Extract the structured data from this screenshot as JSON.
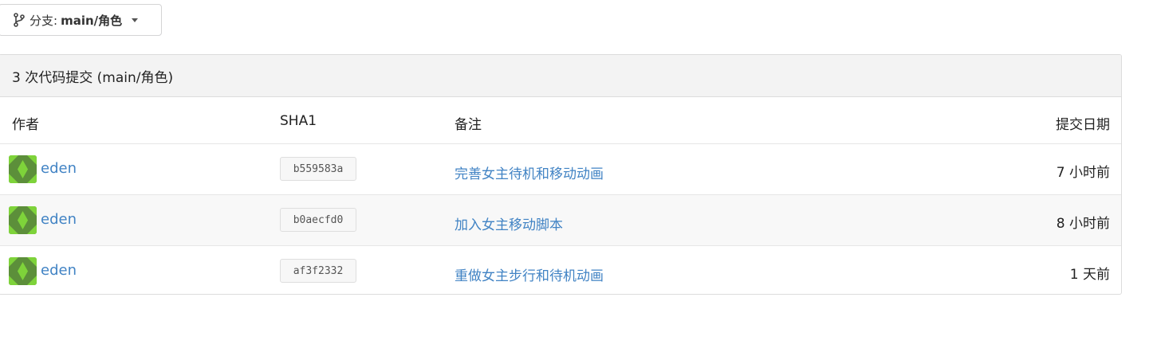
{
  "branch": {
    "prefix": "分支:",
    "name": "main/角色"
  },
  "commits": {
    "header": "3 次代码提交 (main/角色)",
    "columns": {
      "author": "作者",
      "sha": "SHA1",
      "message": "备注",
      "date": "提交日期"
    },
    "rows": [
      {
        "author": "eden",
        "sha": "b559583a",
        "message": "完善女主待机和移动动画",
        "date": "7 小时前"
      },
      {
        "author": "eden",
        "sha": "b0aecfd0",
        "message": "加入女主移动脚本",
        "date": "8 小时前"
      },
      {
        "author": "eden",
        "sha": "af3f2332",
        "message": "重做女主步行和待机动画",
        "date": "1 天前"
      }
    ]
  },
  "colors": {
    "link": "#4183c4",
    "avatar_bg": "#5c8f3a",
    "avatar_fg": "#7ed33a"
  }
}
